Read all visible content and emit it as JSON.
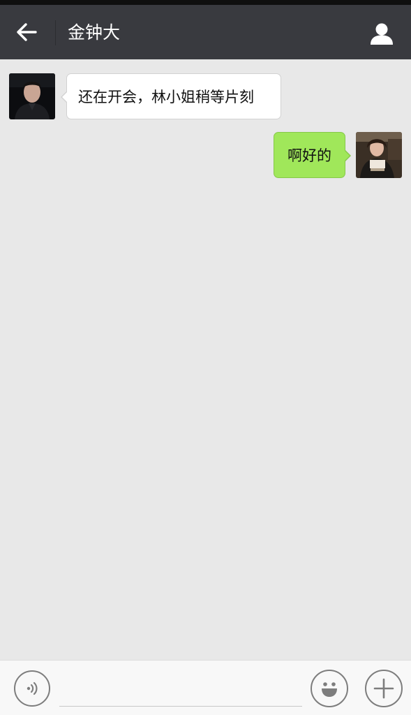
{
  "header": {
    "title": "金钟大",
    "back_icon": "arrow-left-icon",
    "profile_icon": "user-icon",
    "background": "#393a3f"
  },
  "messages": [
    {
      "direction": "incoming",
      "text": "还在开会，林小姐稍等片刻",
      "bubble_color": "#ffffff"
    },
    {
      "direction": "outgoing",
      "text": "啊好的",
      "bubble_color": "#a0e75a"
    }
  ],
  "input_bar": {
    "voice_icon": "voice-icon",
    "message_value": "",
    "emoji_icon": "smiley-icon",
    "plus_icon": "plus-icon"
  },
  "colors": {
    "chat_background": "#e8e8e8",
    "outgoing_bubble": "#a0e75a",
    "incoming_bubble": "#ffffff"
  }
}
